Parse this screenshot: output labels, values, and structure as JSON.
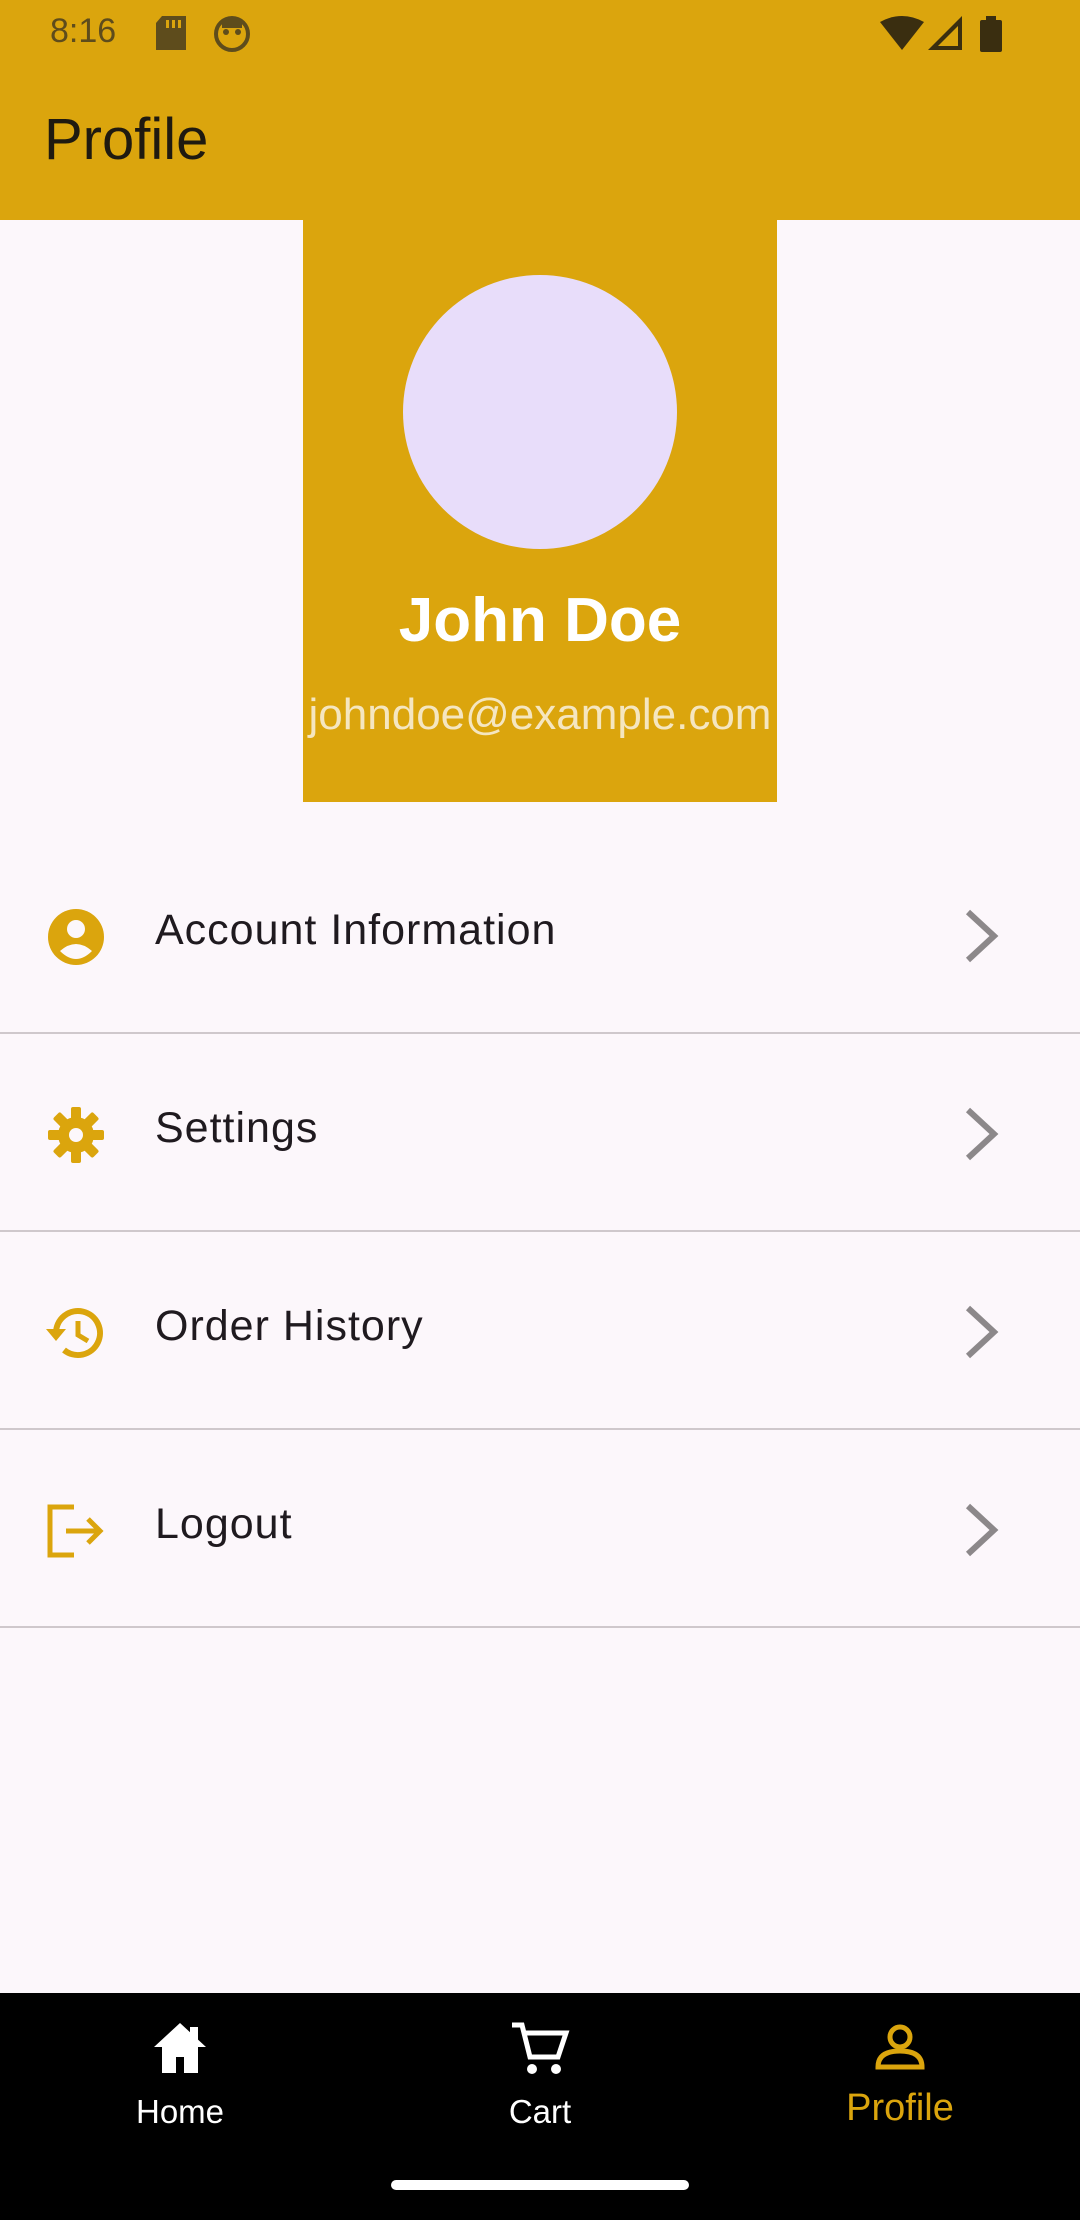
{
  "status_bar": {
    "time": "8:16",
    "icons": [
      "sd-card-icon",
      "face-icon",
      "wifi-icon",
      "signal-icon",
      "battery-icon"
    ]
  },
  "app_bar": {
    "title": "Profile"
  },
  "profile": {
    "name": "John Doe",
    "email": "johndoe@example.com"
  },
  "menu": [
    {
      "label": "Account Information",
      "icon": "account-circle-icon"
    },
    {
      "label": "Settings",
      "icon": "gear-icon"
    },
    {
      "label": "Order History",
      "icon": "history-icon"
    },
    {
      "label": "Logout",
      "icon": "logout-icon"
    }
  ],
  "bottom_nav": [
    {
      "label": "Home",
      "icon": "home-icon",
      "active": false
    },
    {
      "label": "Cart",
      "icon": "cart-icon",
      "active": false
    },
    {
      "label": "Profile",
      "icon": "person-icon",
      "active": true
    }
  ],
  "colors": {
    "accent": "#DBA50D",
    "background": "#FCF7FB",
    "avatar": "#E8DDFA",
    "nav_background": "#000000"
  }
}
